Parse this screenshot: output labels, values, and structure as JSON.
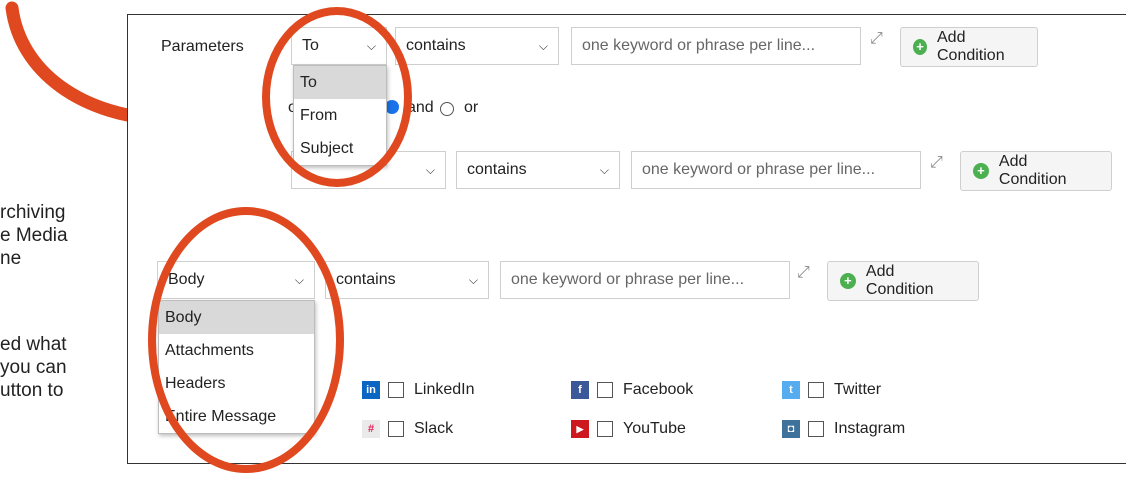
{
  "side_text": [
    "rchiving",
    "e Media",
    "ne",
    "ed what",
    "you can",
    "utton to"
  ],
  "panel": {
    "parameters_label": "Parameters",
    "row1": {
      "field_value": "To",
      "operator_value": "contains",
      "keyword_placeholder": "one keyword or phrase per line...",
      "add_label": "Add Condition"
    },
    "field_dropdown": [
      "To",
      "From",
      "Subject"
    ],
    "match": {
      "partial_label": "o",
      "and_label": "and",
      "or_label": "or"
    },
    "row2": {
      "operator_value": "contains",
      "keyword_placeholder": "one keyword or phrase per line...",
      "add_label": "Add Condition"
    },
    "row3": {
      "field_value": "Body",
      "operator_value": "contains",
      "keyword_placeholder": "one keyword or phrase per line...",
      "add_label": "Add Condition"
    },
    "body_dropdown": [
      "Body",
      "Attachments",
      "Headers",
      "Entire Message"
    ],
    "social": [
      {
        "name": "LinkedIn",
        "icon": "linkedin-icon",
        "glyph": "in",
        "color": "#0a66c2"
      },
      {
        "name": "Facebook",
        "icon": "facebook-icon",
        "glyph": "f",
        "color": "#3b5998"
      },
      {
        "name": "Twitter",
        "icon": "twitter-icon",
        "glyph": "t",
        "color": "#55acee"
      },
      {
        "name": "Slack",
        "icon": "slack-icon",
        "glyph": "#",
        "color": "#e8e8e8"
      },
      {
        "name": "YouTube",
        "icon": "youtube-icon",
        "glyph": "▶",
        "color": "#cc181e"
      },
      {
        "name": "Instagram",
        "icon": "instagram-icon",
        "glyph": "◘",
        "color": "#3f729b"
      }
    ]
  },
  "colors": {
    "annotation": "#e0491f",
    "add_icon": "#4caf50"
  }
}
